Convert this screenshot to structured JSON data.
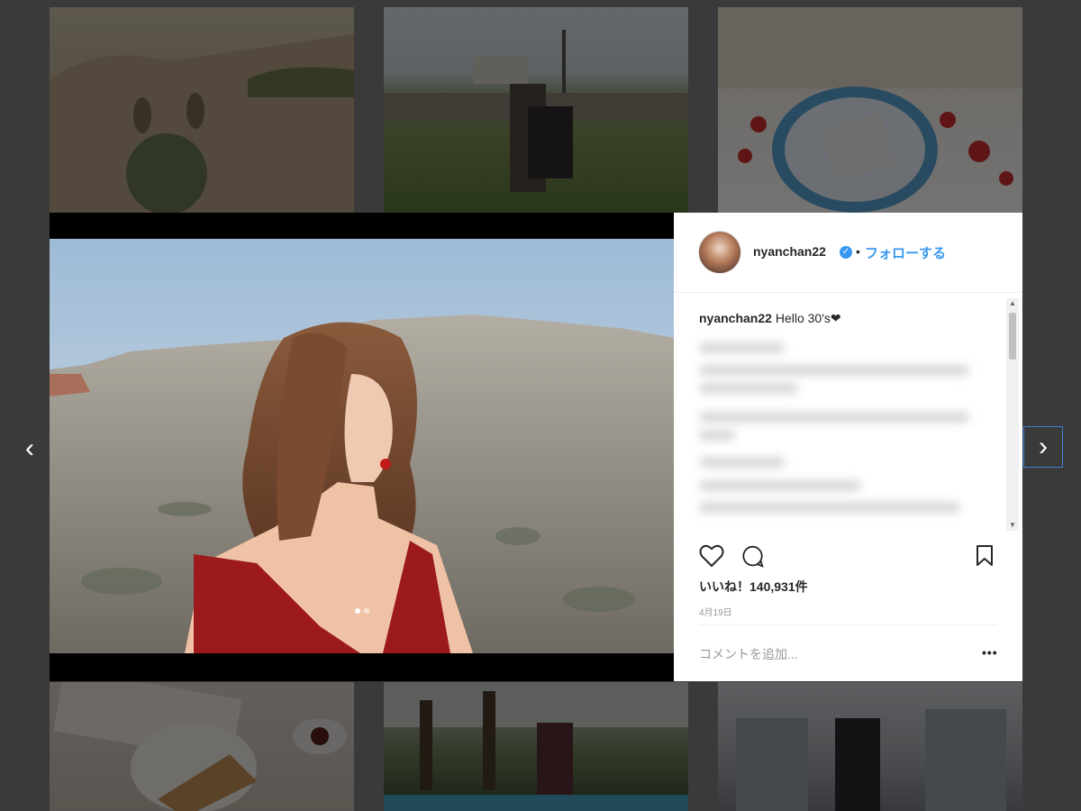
{
  "post": {
    "username": "nyanchan22",
    "separator": "•",
    "follow_label": "フォローする",
    "caption_user": "nyanchan22",
    "caption_text": "Hello 30's❤",
    "likes": "いいね！140,931件",
    "date": "4月19日",
    "comment_placeholder": "コメントを追加...",
    "more_label": "•••",
    "verified_icon": "✓",
    "carousel_count": 2,
    "carousel_active": 0
  },
  "nav": {
    "prev_glyph": "‹",
    "next_glyph": "›"
  },
  "scroll": {
    "up_glyph": "▲",
    "down_glyph": "▼"
  },
  "colors": {
    "link_blue": "#3897f0",
    "overlay": "#3a3a3a"
  },
  "icons": [
    "heart-icon",
    "comment-icon",
    "bookmark-icon",
    "more-icon",
    "verified-icon",
    "chevron-left-icon",
    "chevron-right-icon"
  ]
}
